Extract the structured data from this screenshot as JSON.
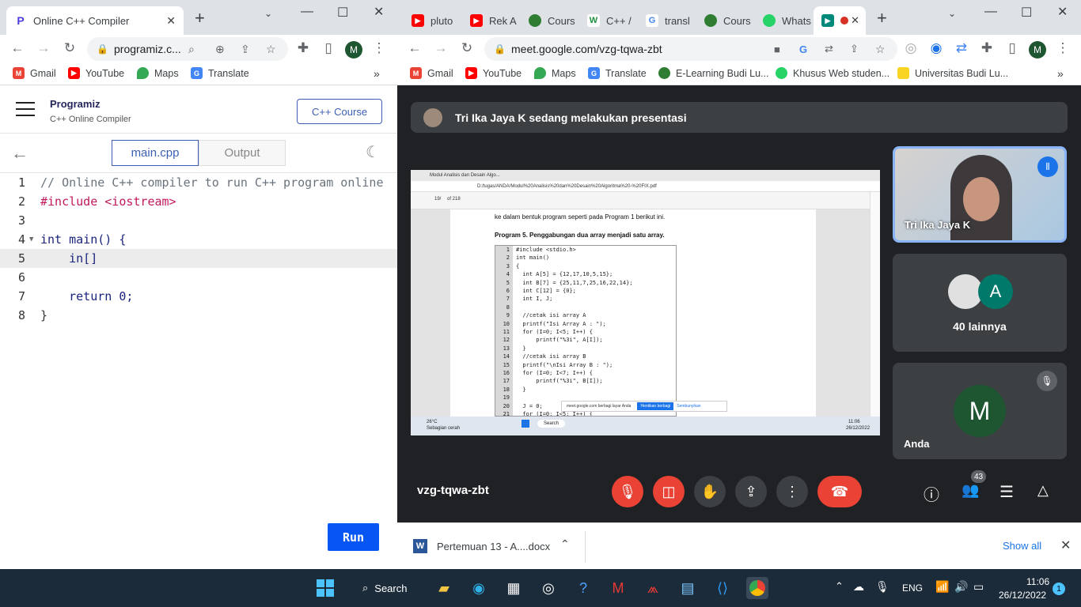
{
  "left_browser": {
    "tab": {
      "title": "Online C++ Compiler"
    },
    "url": "programiz.c...",
    "bookmarks": [
      "Gmail",
      "YouTube",
      "Maps",
      "Translate"
    ],
    "site": {
      "logo": "Programiz",
      "subtitle": "C++ Online Compiler",
      "course_button": "C++ Course",
      "file_tab": "main.cpp",
      "output_tab": "Output",
      "run_button": "Run"
    },
    "code_lines": [
      {
        "n": "1",
        "text": "// Online C++ compiler to run C++ program online"
      },
      {
        "n": "2",
        "text": "#include <iostream>"
      },
      {
        "n": "3",
        "text": ""
      },
      {
        "n": "4",
        "text": "int main() {"
      },
      {
        "n": "5",
        "text": "    in[]"
      },
      {
        "n": "6",
        "text": ""
      },
      {
        "n": "7",
        "text": "    return 0;"
      },
      {
        "n": "8",
        "text": "}"
      }
    ]
  },
  "right_browser": {
    "tabs": [
      "pluto",
      "Rek A",
      "Cours",
      "C++ /",
      "transl",
      "Cours",
      "Whats"
    ],
    "url": "meet.google.com/vzg-tqwa-zbt",
    "bookmarks": [
      "Gmail",
      "YouTube",
      "Maps",
      "Translate",
      "E-Learning Budi Lu...",
      "Khusus Web studen...",
      "Universitas Budi Lu..."
    ],
    "meet": {
      "presenting_banner": "Tri Ika Jaya K sedang melakukan presentasi",
      "tile_presenter": "Tri Ika Jaya K",
      "tile_others": "40 lainnya",
      "tile_others_initial": "A",
      "tile_self": "Anda",
      "tile_self_initial": "M",
      "meeting_code": "vzg-tqwa-zbt",
      "people_count": "43"
    },
    "slide": {
      "pdf_tab": "Modul Analisis dan Desain Algo...",
      "pdf_url": "D:/tugas/ANDA/Modul%20Analisis%20dan%20Desain%20Algoritma%20-%20FIX.pdf",
      "page_num": "19/",
      "page_total": "of 218",
      "intro": "ke dalam bentuk program seperti pada Program 1 berikut ini.",
      "heading": "Program 5. Penggabungan dua array menjadi satu array.",
      "code_lines": [
        {
          "n": "1",
          "t": "#include <stdio.h>"
        },
        {
          "n": "2",
          "t": "int main()"
        },
        {
          "n": "3",
          "t": "{"
        },
        {
          "n": "4",
          "t": "  int A[5] = {12,17,10,5,15};"
        },
        {
          "n": "5",
          "t": "  int B[7] = {25,11,7,25,16,22,14};"
        },
        {
          "n": "6",
          "t": "  int C[12] = {0};"
        },
        {
          "n": "7",
          "t": "  int I, J;"
        },
        {
          "n": "8",
          "t": ""
        },
        {
          "n": "9",
          "t": "  //cetak isi array A"
        },
        {
          "n": "10",
          "t": "  printf(\"Isi Array A : \");"
        },
        {
          "n": "11",
          "t": "  for (I=0; I<5; I++) {"
        },
        {
          "n": "12",
          "t": "      printf(\"%3i\", A[I]);"
        },
        {
          "n": "13",
          "t": "  }"
        },
        {
          "n": "14",
          "t": "  //cetak isi array B"
        },
        {
          "n": "15",
          "t": "  printf(\"\\nIsi Array B : \");"
        },
        {
          "n": "16",
          "t": "  for (I=0; I<7; I++) {"
        },
        {
          "n": "17",
          "t": "      printf(\"%3i\", B[I]);"
        },
        {
          "n": "18",
          "t": "  }"
        },
        {
          "n": "19",
          "t": ""
        },
        {
          "n": "20",
          "t": "  J = 0;"
        },
        {
          "n": "21",
          "t": "  for (I=0; I<5; I++) {"
        }
      ],
      "share_notice": "meet.google.com berbagi layar Anda",
      "share_stop": "Hentikan berbagi",
      "share_hide": "Sembunyikan",
      "weather": "26°C",
      "weather_sub": "Sebagian cerah",
      "search": "Search",
      "time": "11:06",
      "date": "26/12/2022"
    },
    "download": {
      "file": "Pertemuan 13 - A....docx",
      "show_all": "Show all"
    }
  },
  "taskbar": {
    "search": "Search",
    "lang": "ENG",
    "time": "11:06",
    "date": "26/12/2022",
    "notif": "1"
  }
}
